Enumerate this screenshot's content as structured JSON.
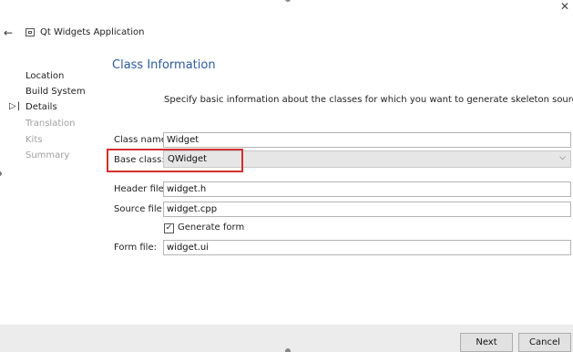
{
  "window": {
    "close_icon": "close-icon",
    "back_icon": "back-arrow-icon",
    "app_icon": "window-icon",
    "title": "Qt Widgets Application"
  },
  "nav": {
    "marker": "▷|",
    "items": [
      {
        "label": "Location",
        "state": "done"
      },
      {
        "label": "Build System",
        "state": "done"
      },
      {
        "label": "Details",
        "state": "current"
      },
      {
        "label": "Translation",
        "state": "pending"
      },
      {
        "label": "Kits",
        "state": "pending"
      },
      {
        "label": "Summary",
        "state": "pending"
      }
    ]
  },
  "page": {
    "title": "Class Information",
    "intro": "Specify basic information about the classes for which you want to generate skeleton source code files.",
    "title_color": "#2c5aa0"
  },
  "form": {
    "class_name": {
      "label": "Class name:",
      "value": "Widget"
    },
    "base_class": {
      "label": "Base class:",
      "value": "QWidget"
    },
    "header_file": {
      "label": "Header file:",
      "value": "widget.h"
    },
    "source_file": {
      "label": "Source file:",
      "value": "widget.cpp"
    },
    "generate_form": {
      "label": "Generate form",
      "checked": true,
      "check_glyph": "✓"
    },
    "form_file": {
      "label": "Form file:",
      "value": "widget.ui"
    }
  },
  "annotation": {
    "color": "#d32f2f"
  },
  "footer": {
    "next_label": "Next",
    "cancel_label": "Cancel"
  }
}
